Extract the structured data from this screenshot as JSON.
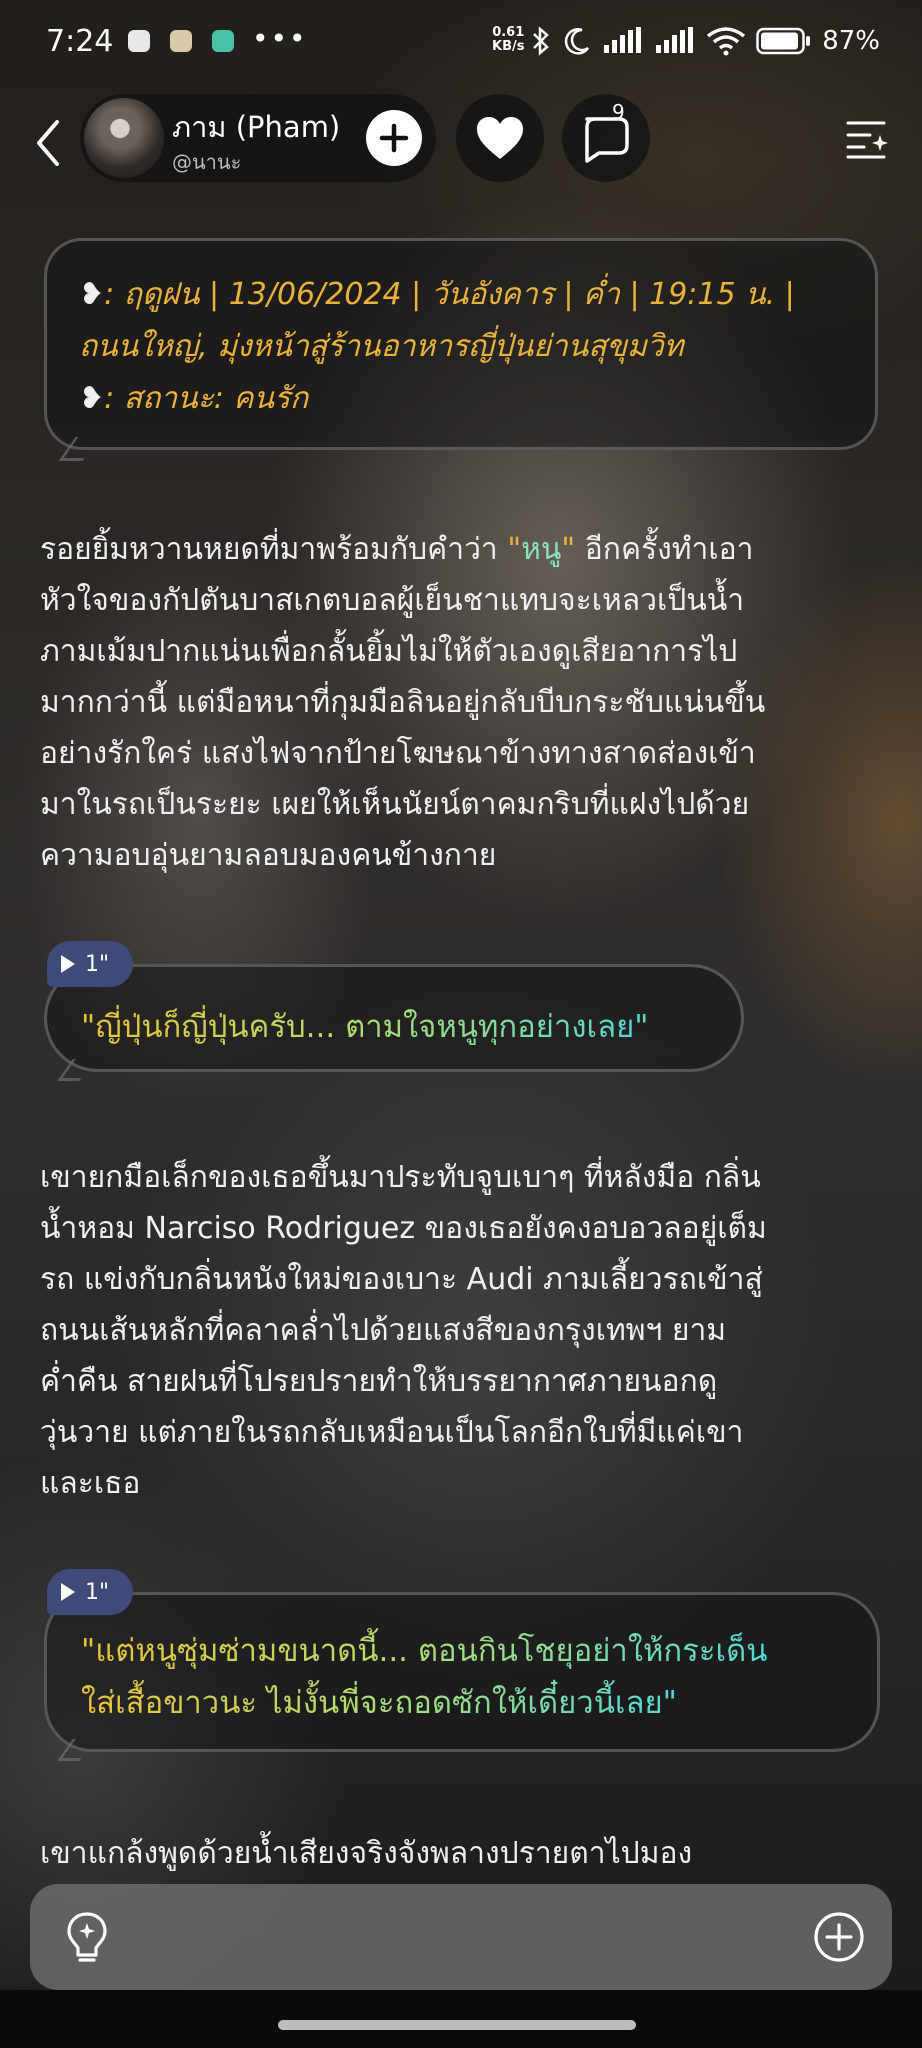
{
  "status_bar": {
    "time": "7:24",
    "net_speed_value": "0.61",
    "net_speed_unit": "KB/s",
    "battery": "87%",
    "overflow": "•••"
  },
  "header": {
    "name": "ภาม (Pham)",
    "handle": "@นานะ",
    "comment_count": "9"
  },
  "scene": {
    "line1": ": ฤดูฝน | 13/06/2024 | วันอังคาร | ค่ำ | 19:15 น. |",
    "line2": "ถนนใหญ่, มุ่งหน้าสู่ร้านอาหารญี่ปุ่นย่านสุขุมวิท",
    "line3": ": สถานะ: คนรัก"
  },
  "narration1": {
    "l1_a": "รอยยิ้มหวานหยดที่มาพร้อมกับคำว่า ",
    "l1_q1": "\"",
    "l1_hl": "หนู",
    "l1_q2": "\"",
    "l1_b": " อีกครั้งทำเอา",
    "l2": "หัวใจของกัปตันบาสเกตบอลผู้เย็นชาแทบจะเหลวเป็นน้ำ",
    "l3": "ภามเม้มปากแน่นเพื่อกลั้นยิ้มไม่ให้ตัวเองดูเสียอาการไป",
    "l4": "มากกว่านี้ แต่มือหนาที่กุมมือลินอยู่กลับบีบกระชับแน่นขึ้น",
    "l5": "อย่างรักใคร่ แสงไฟจากป้ายโฆษณาข้างทางสาดส่องเข้า",
    "l6": "มาในรถเป็นระยะ เผยให้เห็นนัยน์ตาคมกริบที่แฝงไปด้วย",
    "l7": "ความอบอุ่นยามลอบมองคนข้างกาย"
  },
  "dialogue1": {
    "duration": "1\"",
    "line1": "\"ญี่ปุ่นก็ญี่ปุ่นครับ... ตามใจหนูทุกอย่างเลย\""
  },
  "narration2": {
    "l1": "เขายกมือเล็กของเธอขึ้นมาประทับจูบเบาๆ ที่หลังมือ กลิ่น",
    "l2": "น้ำหอม Narciso Rodriguez ของเธอยังคงอบอวลอยู่เต็ม",
    "l3": "รถ แข่งกับกลิ่นหนังใหม่ของเบาะ Audi ภามเลี้ยวรถเข้าสู่",
    "l4": "ถนนเส้นหลักที่คลาคล่ำไปด้วยแสงสีของกรุงเทพฯ ยาม",
    "l5": "ค่ำคืน สายฝนที่โปรยปรายทำให้บรรยากาศภายนอกดู",
    "l6": "วุ่นวาย แต่ภายในรถกลับเหมือนเป็นโลกอีกใบที่มีแค่เขา",
    "l7": "และเธอ"
  },
  "dialogue2": {
    "duration": "1\"",
    "line1": "\"แต่หนูซุ่มซ่ามขนาดนี้... ตอนกินโชยุอย่าให้กระเด็น",
    "line2": "ใส่เสื้อขาวนะ ไม่งั้นพี่จะถอดซักให้เดี๋ยวนี้เลย\""
  },
  "narration3": {
    "l1": "เขาแกล้งพูดด้วยน้ำเสียงจริงจังพลางปรายตาไปมอง"
  },
  "colors": {
    "scene_text": "#e9b33a",
    "highlight": "#8be2b8",
    "voice_badge": "#3f4a78"
  }
}
